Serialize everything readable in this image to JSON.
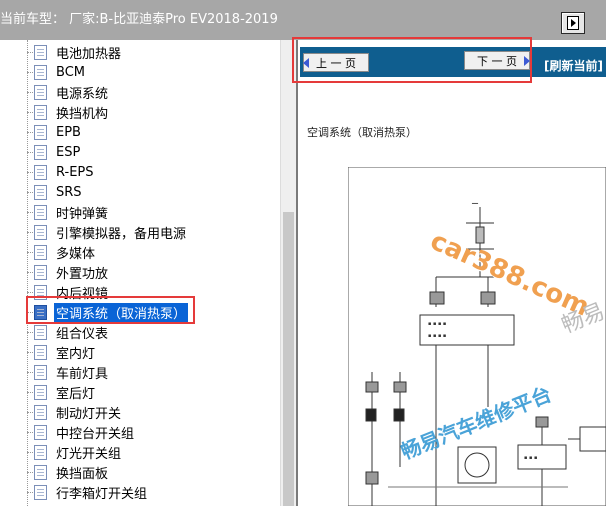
{
  "topbar": {
    "title": "当前车型： 厂家:B-比亚迪泰Pro EV2018-2019"
  },
  "tree": {
    "items": [
      {
        "label": "电池加热器"
      },
      {
        "label": "BCM"
      },
      {
        "label": "电源系统"
      },
      {
        "label": "换挡机构"
      },
      {
        "label": "EPB"
      },
      {
        "label": "ESP"
      },
      {
        "label": "R-EPS"
      },
      {
        "label": "SRS"
      },
      {
        "label": "时钟弹簧"
      },
      {
        "label": "引擎模拟器，备用电源"
      },
      {
        "label": "多媒体"
      },
      {
        "label": "外置功放"
      },
      {
        "label": "内后视镜"
      },
      {
        "label": "空调系统（取消热泵）"
      },
      {
        "label": "组合仪表"
      },
      {
        "label": "室内灯"
      },
      {
        "label": "车前灯具"
      },
      {
        "label": "室后灯"
      },
      {
        "label": "制动灯开关"
      },
      {
        "label": "中控台开关组"
      },
      {
        "label": "灯光开关组"
      },
      {
        "label": "换挡面板"
      },
      {
        "label": "行李箱灯开关组"
      }
    ],
    "selected_index": 13
  },
  "nav": {
    "prev_label": "上 一 页",
    "next_label": "下 一 页",
    "refresh_label": "[刷新当前]"
  },
  "page": {
    "heading": "空调系统（取消热泵）"
  },
  "watermarks": {
    "site": "car388.com",
    "cn": "畅易汽车维修平台",
    "gray": "畅易"
  },
  "colors": {
    "topbar": "#a7a7a7",
    "navbar": "#0f5e8f",
    "selection": "#0a64d6",
    "highlight_box": "#e53a3a"
  }
}
